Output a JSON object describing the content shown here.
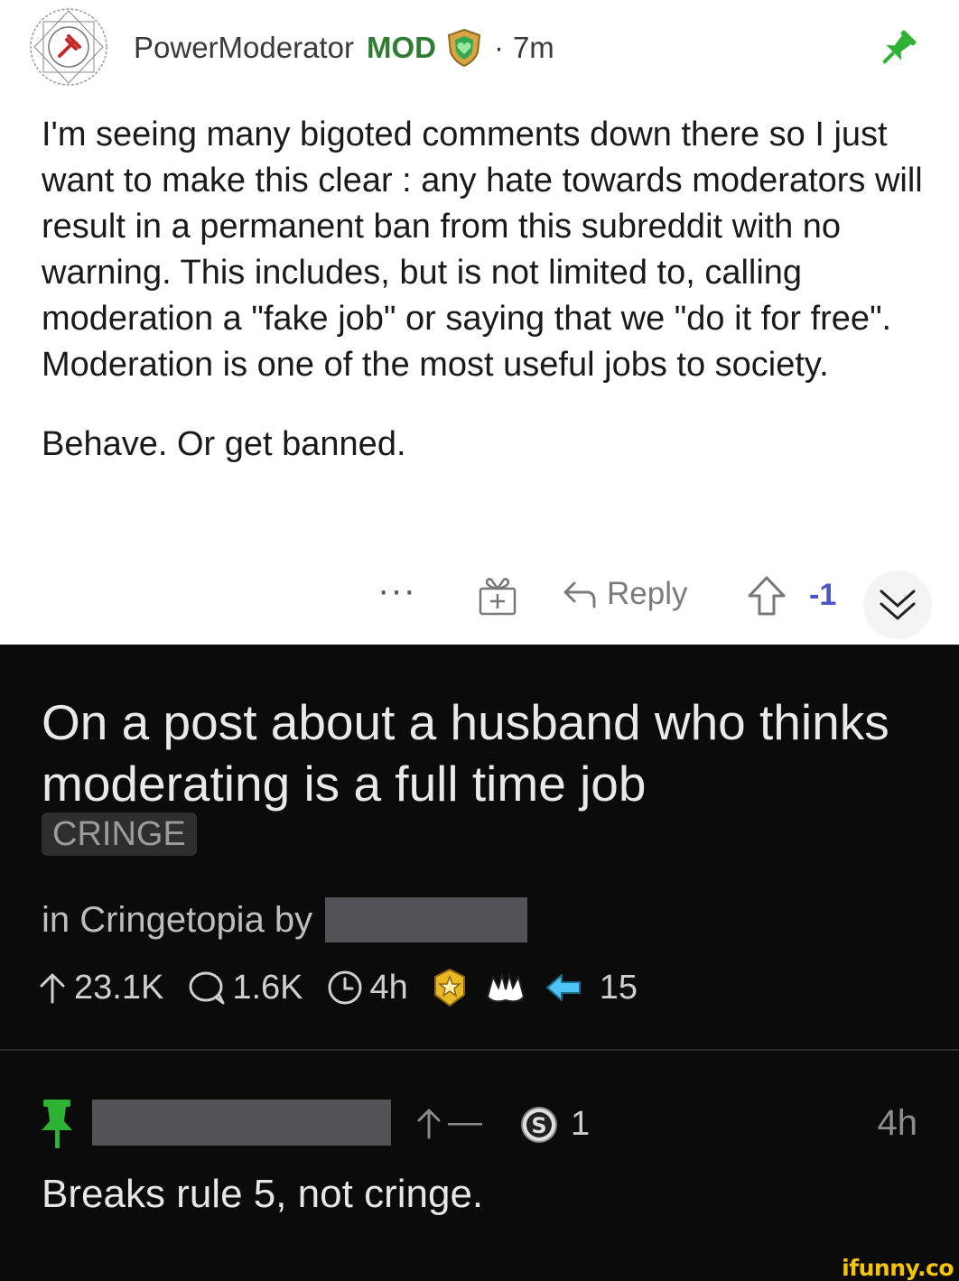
{
  "mod_comment": {
    "username": "PowerModerator",
    "mod_tag": "MOD",
    "separator": "·",
    "time": "7m",
    "paragraph1": "I'm seeing many bigoted comments down there so I just want to make this clear : any hate towards moderators will result in a permanent ban from this subreddit with no warning. This includes, but is not limited to, calling moderation a \"fake job\" or saying that we \"do it for free\". Moderation is one of the most useful jobs to society.",
    "paragraph2": "Behave. Or get banned.",
    "more_label": "···",
    "reply_label": "Reply",
    "score": "-1"
  },
  "post": {
    "title": "On a post about a husband who thinks moderating is a full time job",
    "flair": "CRINGE",
    "subreddit_prefix": "in Cringetopia by",
    "upvotes": "23.1K",
    "comments": "1.6K",
    "age": "4h",
    "award_count": "15"
  },
  "reply_comment": {
    "vote_label": "—",
    "award_count": "1",
    "time": "4h",
    "text": "Breaks rule 5, not cringe."
  },
  "watermark": "ifunny.co",
  "colors": {
    "mod_green": "#2e7d32",
    "score_blue": "#4a55c9",
    "pin_green": "#2db234",
    "dark_bg": "#0b0b0b",
    "watermark_yellow": "#f6c400"
  }
}
